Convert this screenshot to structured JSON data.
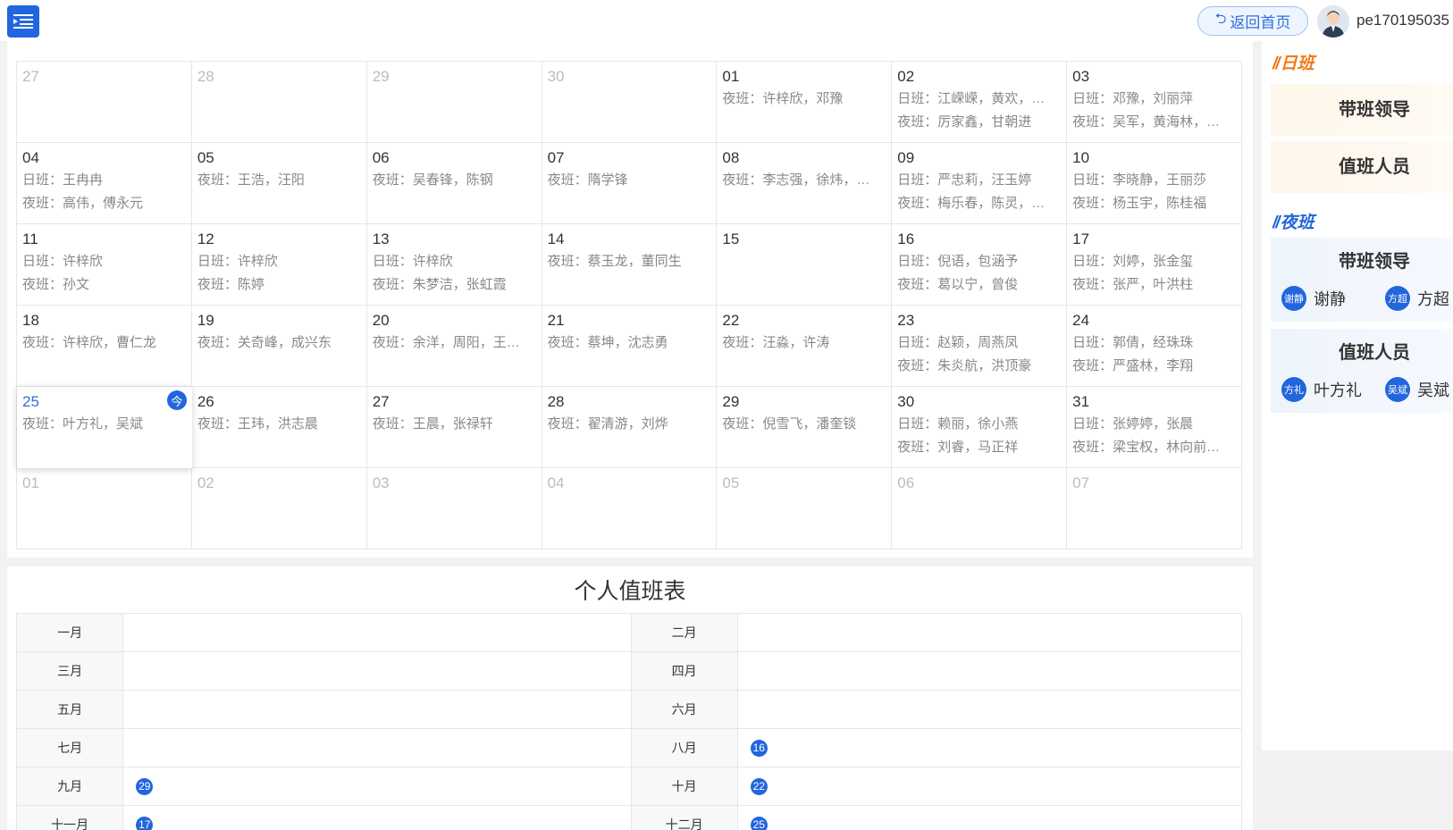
{
  "header": {
    "back_label": "返回首页",
    "username": "pe170195035"
  },
  "calendar": {
    "weeks": [
      [
        {
          "num": "27",
          "other": true,
          "lines": []
        },
        {
          "num": "28",
          "other": true,
          "lines": []
        },
        {
          "num": "29",
          "other": true,
          "lines": []
        },
        {
          "num": "30",
          "other": true,
          "lines": []
        },
        {
          "num": "01",
          "lines": [
            "夜班：许梓欣，邓豫"
          ]
        },
        {
          "num": "02",
          "lines": [
            "日班：江嵘嵘，黄欢，…",
            "夜班：厉家鑫，甘朝进"
          ]
        },
        {
          "num": "03",
          "lines": [
            "日班：邓豫，刘丽萍",
            "夜班：吴军，黄海林，…"
          ]
        }
      ],
      [
        {
          "num": "04",
          "lines": [
            "日班：王冉冉",
            "夜班：高伟，傅永元"
          ]
        },
        {
          "num": "05",
          "lines": [
            "夜班：王浩，汪阳"
          ]
        },
        {
          "num": "06",
          "lines": [
            "夜班：吴春锋，陈钢"
          ]
        },
        {
          "num": "07",
          "lines": [
            "夜班：隋学锋"
          ]
        },
        {
          "num": "08",
          "lines": [
            "夜班：李志强，徐炜，…"
          ]
        },
        {
          "num": "09",
          "lines": [
            "日班：严忠莉，汪玉婷",
            "夜班：梅乐春，陈灵，…"
          ]
        },
        {
          "num": "10",
          "lines": [
            "日班：李晓静，王丽莎",
            "夜班：杨玉宇，陈桂福"
          ]
        }
      ],
      [
        {
          "num": "11",
          "lines": [
            "日班：许梓欣",
            "夜班：孙文"
          ]
        },
        {
          "num": "12",
          "lines": [
            "日班：许梓欣",
            "夜班：陈婷"
          ]
        },
        {
          "num": "13",
          "lines": [
            "日班：许梓欣",
            "夜班：朱梦洁，张虹霞"
          ]
        },
        {
          "num": "14",
          "lines": [
            "夜班：蔡玉龙，董同生"
          ]
        },
        {
          "num": "15",
          "lines": []
        },
        {
          "num": "16",
          "lines": [
            "日班：倪语，包涵予",
            "夜班：葛以宁，曾俊"
          ]
        },
        {
          "num": "17",
          "lines": [
            "日班：刘婷，张金玺",
            "夜班：张严，叶洪柱"
          ]
        }
      ],
      [
        {
          "num": "18",
          "lines": [
            "夜班：许梓欣，曹仁龙"
          ]
        },
        {
          "num": "19",
          "lines": [
            "夜班：关奇峰，成兴东"
          ]
        },
        {
          "num": "20",
          "lines": [
            "夜班：余洋，周阳，王…"
          ]
        },
        {
          "num": "21",
          "lines": [
            "夜班：蔡坤，沈志勇"
          ]
        },
        {
          "num": "22",
          "lines": [
            "夜班：汪淼，许涛"
          ]
        },
        {
          "num": "23",
          "lines": [
            "日班：赵颖，周燕凤",
            "夜班：朱炎航，洪顶豪"
          ]
        },
        {
          "num": "24",
          "lines": [
            "日班：郭倩，经珠珠",
            "夜班：严盛林，李翔"
          ]
        }
      ],
      [
        {
          "num": "25",
          "today": true,
          "lines": [
            "夜班：叶方礼，吴斌"
          ]
        },
        {
          "num": "26",
          "lines": [
            "夜班：王玮，洪志晨"
          ]
        },
        {
          "num": "27",
          "lines": [
            "夜班：王晨，张禄轩"
          ]
        },
        {
          "num": "28",
          "lines": [
            "夜班：翟清游，刘烨"
          ]
        },
        {
          "num": "29",
          "lines": [
            "夜班：倪雪飞，潘奎锬"
          ]
        },
        {
          "num": "30",
          "lines": [
            "日班：赖丽，徐小燕",
            "夜班：刘睿，马正祥"
          ]
        },
        {
          "num": "31",
          "lines": [
            "日班：张婷婷，张晨",
            "夜班：梁宝权，林向前…"
          ]
        }
      ],
      [
        {
          "num": "01",
          "other": true,
          "lines": []
        },
        {
          "num": "02",
          "other": true,
          "lines": []
        },
        {
          "num": "03",
          "other": true,
          "lines": []
        },
        {
          "num": "04",
          "other": true,
          "lines": []
        },
        {
          "num": "05",
          "other": true,
          "lines": []
        },
        {
          "num": "06",
          "other": true,
          "lines": []
        },
        {
          "num": "07",
          "other": true,
          "lines": []
        }
      ]
    ],
    "today_badge": "今"
  },
  "personal": {
    "title": "个人值班表",
    "rows": [
      [
        {
          "month": "一月",
          "days": []
        },
        {
          "month": "二月",
          "days": []
        }
      ],
      [
        {
          "month": "三月",
          "days": []
        },
        {
          "month": "四月",
          "days": []
        }
      ],
      [
        {
          "month": "五月",
          "days": []
        },
        {
          "month": "六月",
          "days": []
        }
      ],
      [
        {
          "month": "七月",
          "days": []
        },
        {
          "month": "八月",
          "days": [
            "16"
          ]
        }
      ],
      [
        {
          "month": "九月",
          "days": [
            "29"
          ]
        },
        {
          "month": "十月",
          "days": [
            "22"
          ]
        }
      ],
      [
        {
          "month": "十一月",
          "days": [
            "17"
          ]
        },
        {
          "month": "十二月",
          "days": [
            "25"
          ]
        }
      ]
    ]
  },
  "sidebar": {
    "day_title": "日班",
    "night_title": "夜班",
    "day_leader_label": "带班领导",
    "day_staff_label": "值班人员",
    "night_leader_label": "带班领导",
    "night_staff_label": "值班人员",
    "night_leaders": [
      {
        "avatar": "谢静",
        "name": "谢静"
      },
      {
        "avatar": "方超",
        "name": "方超"
      }
    ],
    "night_staff": [
      {
        "avatar": "方礼",
        "name": "叶方礼"
      },
      {
        "avatar": "吴斌",
        "name": "吴斌"
      }
    ]
  },
  "colors": {
    "accent": "#2266dd",
    "day_shift": "#f07a1a"
  }
}
